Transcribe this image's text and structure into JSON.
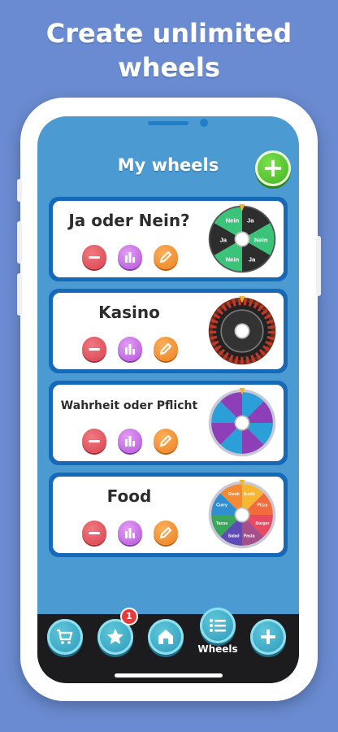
{
  "headline": {
    "line1": "Create unlimited",
    "line2": "wheels"
  },
  "screen_title": "My wheels",
  "add_button_icon": "plus-icon",
  "wheels": [
    {
      "name": "Ja oder Nein?",
      "wheel_labels": [
        "Ja",
        "Nein",
        "Ja",
        "Nein",
        "Ja",
        "Nein"
      ]
    },
    {
      "name": "Kasino"
    },
    {
      "name": "Wahrheit oder Pflicht"
    },
    {
      "name": "Food",
      "wheel_labels": [
        "Sushi",
        "Pizza",
        "Burger",
        "Pasta",
        "Salad",
        "Tacos",
        "Curry",
        "Steak"
      ]
    }
  ],
  "actions": {
    "delete_icon": "minus-icon",
    "stats_icon": "bar-chart-icon",
    "edit_icon": "pencil-icon"
  },
  "nav": {
    "items": [
      {
        "icon": "cart-icon",
        "label": ""
      },
      {
        "icon": "star-icon",
        "label": "",
        "badge": "1"
      },
      {
        "icon": "home-icon",
        "label": ""
      },
      {
        "icon": "list-icon",
        "label": "Wheels"
      },
      {
        "icon": "plus-icon",
        "label": ""
      }
    ]
  },
  "colors": {
    "background": "#6a8bd1",
    "screen": "#4b9bd2",
    "card_border": "#1569b6",
    "add_green": "#4fc22a",
    "delete_red": "#d9404c",
    "stats_purple": "#b354d8",
    "edit_orange": "#ee7f1f",
    "nav_teal": "#2b96b8"
  }
}
